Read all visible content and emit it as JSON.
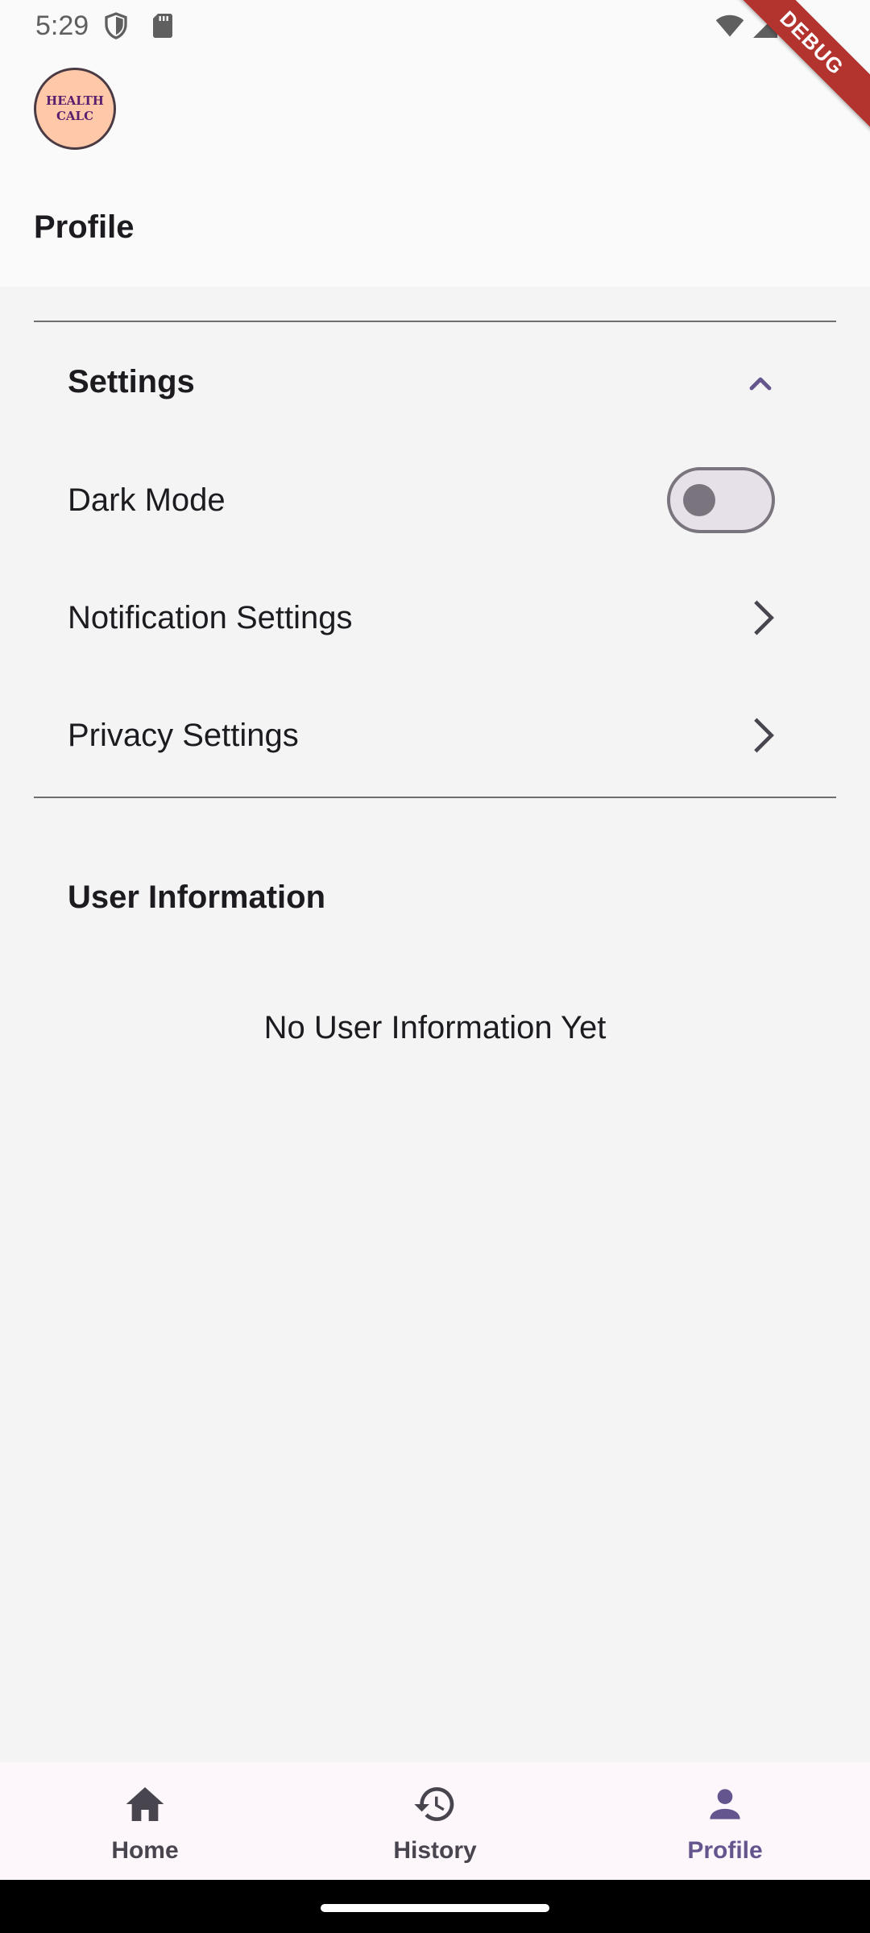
{
  "status_bar": {
    "time": "5:29",
    "icons": [
      "shield-icon",
      "sd-card-icon",
      "wifi-icon",
      "cell-signal-icon",
      "battery-icon"
    ]
  },
  "debug_banner": "DEBUG",
  "header": {
    "logo_line1": "HEALTH",
    "logo_line2": "CALC",
    "title": "Profile"
  },
  "settings": {
    "title": "Settings",
    "expanded": true,
    "items": [
      {
        "label": "Dark Mode",
        "control": "toggle",
        "value": false
      },
      {
        "label": "Notification Settings",
        "control": "chevron-right-icon"
      },
      {
        "label": "Privacy Settings",
        "control": "chevron-right-icon"
      }
    ]
  },
  "user_info": {
    "title": "User Information",
    "empty_message": "No User Information Yet"
  },
  "bottom_nav": {
    "items": [
      {
        "label": "Home",
        "icon": "home-icon",
        "active": false
      },
      {
        "label": "History",
        "icon": "history-icon",
        "active": false
      },
      {
        "label": "Profile",
        "icon": "person-icon",
        "active": true
      }
    ]
  },
  "colors": {
    "accent": "#65558f",
    "background": "#f4f4f4",
    "app_bar": "#fafafa",
    "nav_bar": "#fdf6fb",
    "debug_ribbon": "#b3332f"
  }
}
